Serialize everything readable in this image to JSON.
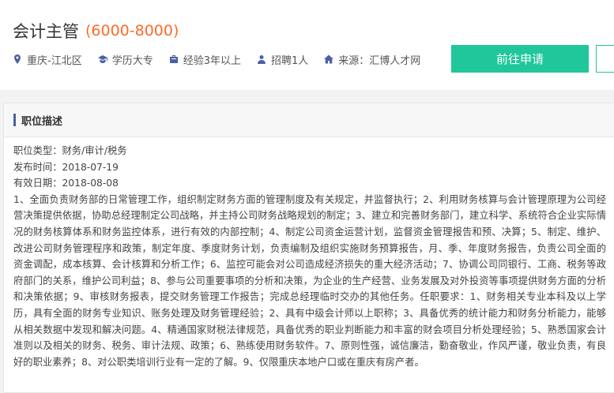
{
  "job": {
    "title": "会计主管",
    "salary": "(6000-8000)",
    "location": "重庆-江北区",
    "education": "学历大专",
    "experience": "经验3年以上",
    "headcount": "招聘1人",
    "source": "来源：汇博人才网"
  },
  "actions": {
    "apply_label": "前往申请"
  },
  "section": {
    "title": "职位描述",
    "category": "职位类型：财务/审计/税务",
    "publish_date": "发布时间：2018-07-19",
    "expire_date": "有效日期：2018-08-08",
    "description": "1、全面负责财务部的日常管理工作，组织制定财务方面的管理制度及有关规定，并监督执行；2、利用财务核算与会计管理原理为公司经营决策提供依据，协助总经理制定公司战略，并主持公司财务战略规划的制定；3、建立和完善财务部门，建立科学、系统符合企业实际情况的财务核算体系和财务监控体系，进行有效的内部控制；4、制定公司资金运营计划，监督资金管理报告和预、决算；5、制定、维护、改进公司财务管理程序和政策，制定年度、季度财务计划，负责编制及组织实施财务预算报告，月、季、年度财务报告，负责公司全面的资金调配，成本核算、会计核算和分析工作；6、监控可能会对公司造成经济损失的重大经济活动；7、协调公司同银行、工商、税务等政府部门的关系，维护公司利益；8、参与公司重要事项的分析和决策，为企业的生产经营、业务发展及对外投资等事项提供财务方面的分析和决策依据；9、审核财务报表，提交财务管理工作报告；完成总经理临时交办的其他任务。任职要求：1、财务相关专业本科及以上学历，具有全面的财务专业知识、账务处理及财务管理经验；2、具有中级会计师以上职称；3、具备优秀的统计能力和财务分析能力，能够从相关数据中发现和解决问题。4、精通国家财税法律规范，具备优秀的职业判断能力和丰富的财会项目分析处理经验；5、熟悉国家会计准则以及相关的财务、税务、审计法规、政策；6、熟练使用财务软件。7、原则性强，诚信廉洁，勤奋敬业，作风严谨，敬业负责，有良好的职业素养；8、对公职类培训行业有一定的了解。9、仅限重庆本地户口或在重庆有房产者。"
  },
  "icons": {
    "location": "location-pin-icon",
    "education": "graduation-cap-icon",
    "experience": "briefcase-icon",
    "headcount": "person-icon",
    "source": "home-icon"
  },
  "colors": {
    "accent": "#1fc79b",
    "salary": "#ff6a2a",
    "icon": "#4a5fa8"
  }
}
